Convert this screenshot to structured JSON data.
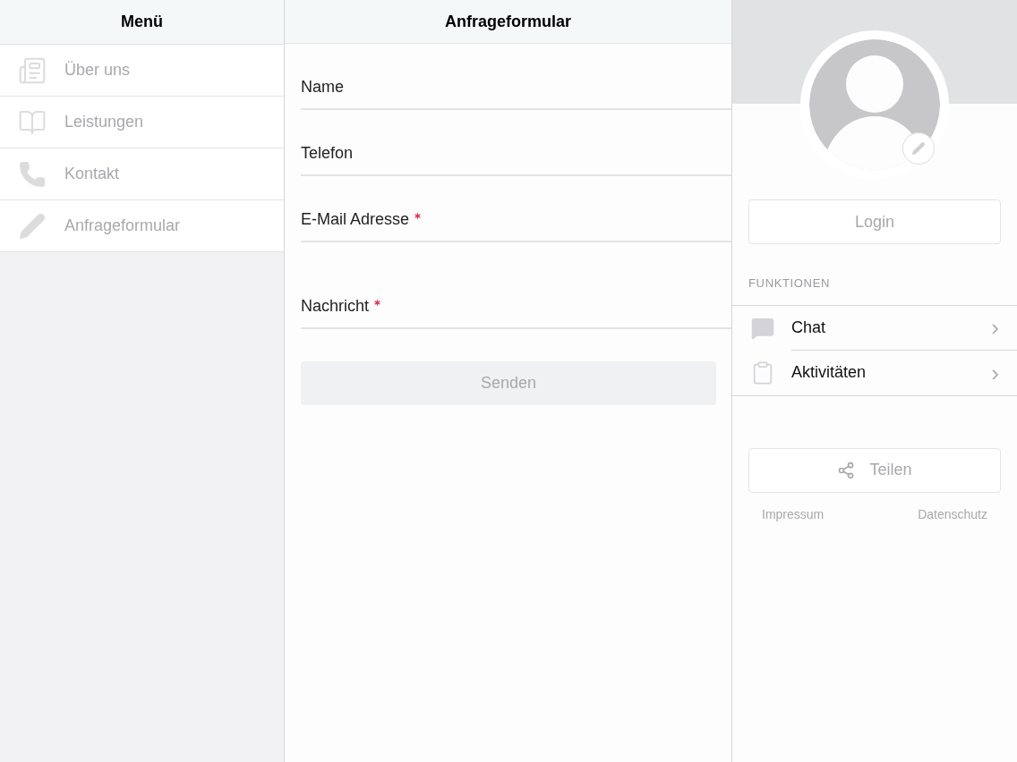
{
  "menu": {
    "title": "Menü",
    "items": [
      {
        "label": "Über uns",
        "disabled": true
      },
      {
        "label": "Leistungen",
        "disabled": true
      },
      {
        "label": "Kontakt",
        "disabled": true
      },
      {
        "label": "Anfrageformular",
        "disabled": true
      }
    ]
  },
  "form": {
    "title": "Anfrageformular",
    "fields": [
      {
        "label": "Name",
        "required": false,
        "kind": "line"
      },
      {
        "label": "Telefon",
        "required": false,
        "kind": "line"
      },
      {
        "label": "E-Mail Adresse",
        "required": true,
        "kind": "line"
      },
      {
        "label": "Nachricht",
        "required": true,
        "kind": "multiline"
      }
    ],
    "submit": {
      "label": "Senden",
      "disabled": true
    }
  },
  "profile": {
    "login": {
      "label": "Login",
      "disabled": true
    },
    "section_title": "FUNKTIONEN",
    "functions": [
      {
        "label": "Chat",
        "chevron": "›"
      },
      {
        "label": "Aktivitäten",
        "chevron": "›"
      }
    ],
    "share": {
      "label": "Teilen",
      "disabled": true
    },
    "links": [
      "Impressum",
      "Datenschutz"
    ]
  }
}
